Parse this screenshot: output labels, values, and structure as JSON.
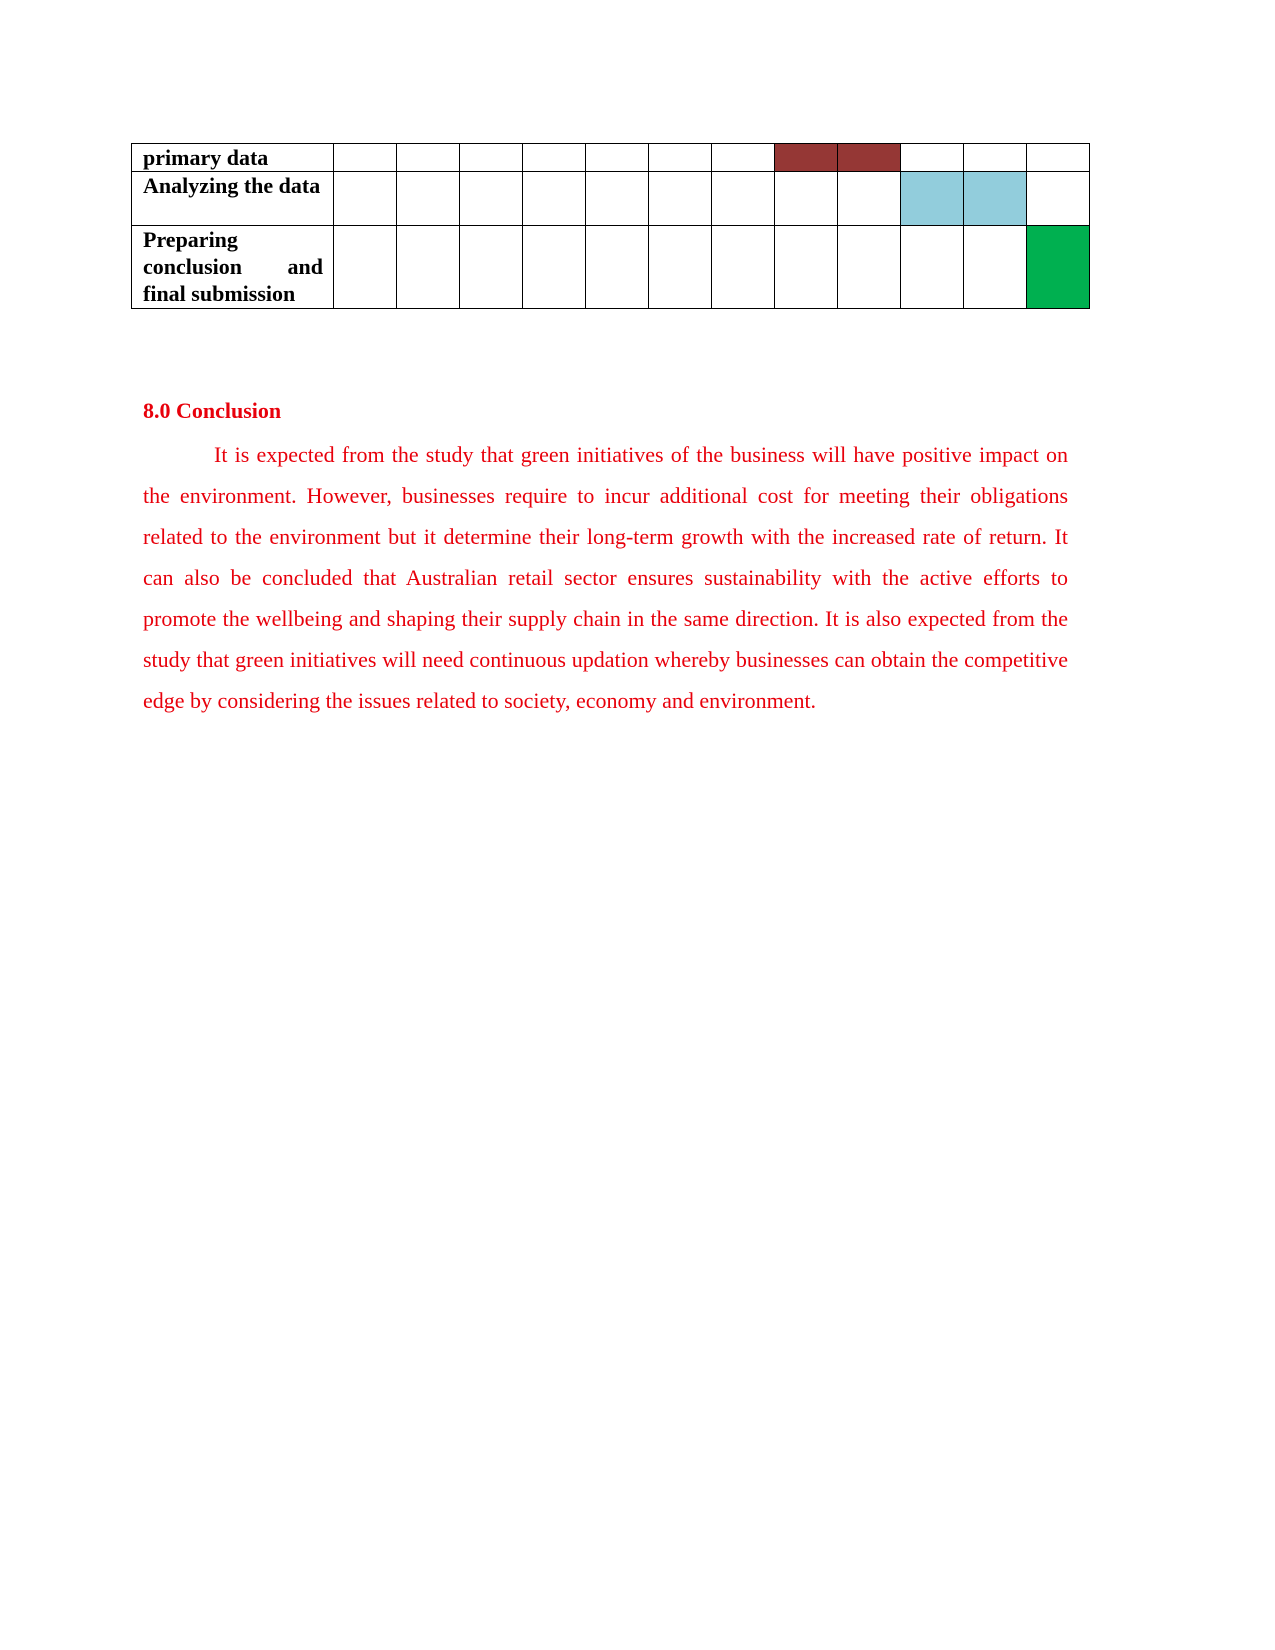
{
  "gantt": {
    "colors": {
      "brown": "#953735",
      "light_blue": "#92CDDC",
      "green": "#00B050"
    },
    "rows": [
      {
        "task": "primary data",
        "height": 27,
        "filled": [
          8,
          9
        ],
        "color": "#953735"
      },
      {
        "task": "Analyzing the data",
        "height": 54,
        "filled": [
          10,
          11
        ],
        "color": "#92CDDC"
      },
      {
        "task": "Preparing conclusion and final submission",
        "height": 83,
        "filled": [
          12
        ],
        "color": "#00B050"
      }
    ],
    "period_count": 12
  },
  "conclusion": {
    "heading": "8.0 Conclusion",
    "text": "It is expected from the study that green initiatives of the business will have positive impact on the environment. However, businesses require to incur additional cost for meeting their obligations related to the environment but it determine their long-term growth with the increased rate of return. It can also be concluded that Australian retail sector ensures sustainability with the active efforts to promote the wellbeing and shaping their supply chain in the same direction. It is also expected from the study that green initiatives will need continuous updation whereby businesses can obtain the competitive edge by considering the issues related to society, economy and environment."
  }
}
